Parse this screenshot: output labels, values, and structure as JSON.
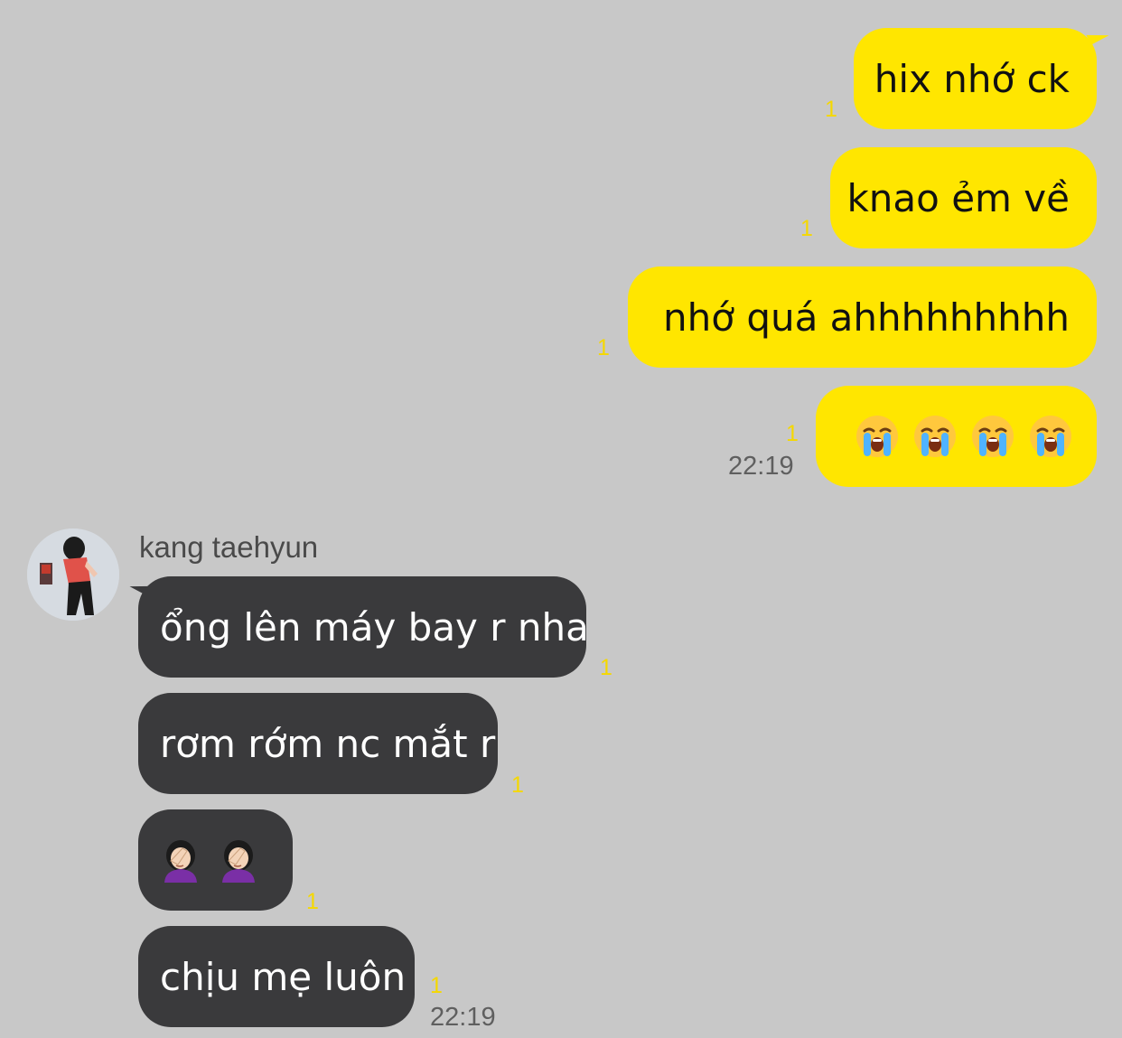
{
  "chat": {
    "outgoing": [
      {
        "text": "hix nhớ ck",
        "unread": "1"
      },
      {
        "text": "knao ẻm về",
        "unread": "1"
      },
      {
        "text": "nhớ quá ahhhhhhhhh",
        "unread": "1"
      },
      {
        "emoji": "loudly-crying-face",
        "count": 4,
        "unread": "1",
        "time": "22:19"
      }
    ],
    "incoming_sender": {
      "name": "kang taehyun",
      "avatar": "avatar-photo"
    },
    "incoming": [
      {
        "text": "ổng lên máy bay r nha",
        "unread": "1"
      },
      {
        "text": "rơm rớm nc mắt r",
        "unread": "1"
      },
      {
        "emoji": "woman-facepalming",
        "count": 2,
        "unread": "1"
      },
      {
        "text": "chịu mẹ luôn",
        "unread": "1",
        "time": "22:19"
      }
    ]
  },
  "colors": {
    "background": "#c8c8c8",
    "outgoing_bubble": "#ffe600",
    "incoming_bubble": "#3a3a3c",
    "unread_count": "#f5d800"
  }
}
